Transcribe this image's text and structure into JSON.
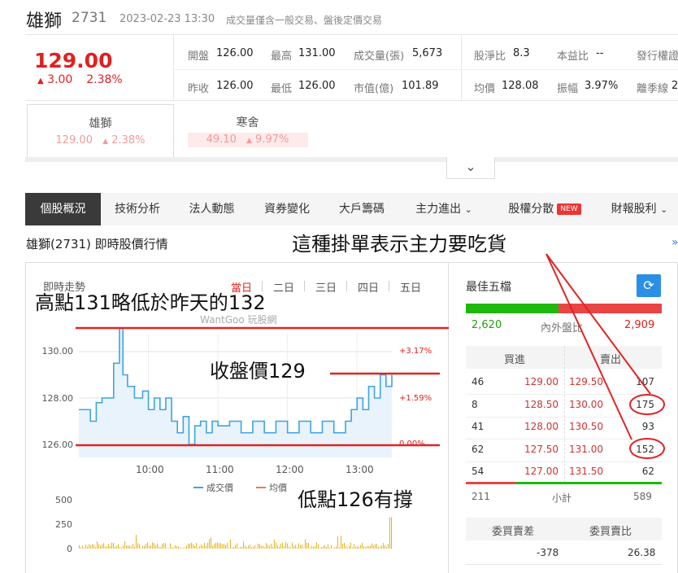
{
  "header": {
    "name": "雄獅",
    "code": "2731",
    "timestamp": "2023-02-23 13:30",
    "note": "成交量僅含一般交易、盤後定價交易"
  },
  "quote": {
    "price": "129.00",
    "change": "3.00",
    "change_pct": "2.38%",
    "fields": [
      {
        "label": "開盤",
        "value": "126.00"
      },
      {
        "label": "最高",
        "value": "131.00"
      },
      {
        "label": "成交量(張)",
        "value": "5,673"
      },
      {
        "label": "股淨比",
        "value": "8.3"
      },
      {
        "label": "本益比",
        "value": "--"
      },
      {
        "label": "發行權證",
        "value": ""
      },
      {
        "label": "昨收",
        "value": "126.00"
      },
      {
        "label": "最低",
        "value": "126.00"
      },
      {
        "label": "市值(億)",
        "value": "101.89"
      },
      {
        "label": "均價",
        "value": "128.08"
      },
      {
        "label": "振幅",
        "value": "3.97%"
      },
      {
        "label": "離季線",
        "value": "2"
      }
    ]
  },
  "related": [
    {
      "name": "雄獅",
      "price": "129.00",
      "pct": "2.38%"
    },
    {
      "name": "寒舍",
      "price": "49.10",
      "pct": "9.97%"
    }
  ],
  "tabs": [
    {
      "label": "個股概況"
    },
    {
      "label": "技術分析"
    },
    {
      "label": "法人動態"
    },
    {
      "label": "資券變化"
    },
    {
      "label": "大戶籌碼"
    },
    {
      "label": "主力進出"
    },
    {
      "label": "股權分散",
      "badge": "NEW"
    },
    {
      "label": "財報股利"
    }
  ],
  "section_title": "雄獅(2731) 即時股價行情",
  "more_link": "»",
  "chart": {
    "title": "即時走勢",
    "ranges": [
      "當日",
      "二日",
      "三日",
      "四日",
      "五日"
    ],
    "watermark": "WantGoo 玩股網",
    "y_ticks": [
      "130.00",
      "128.00",
      "126.00"
    ],
    "pct_ticks": [
      "+3.17%",
      "+1.59%",
      "0.00%"
    ],
    "x_ticks": [
      "10:00",
      "11:00",
      "12:00",
      "13:00"
    ],
    "legend": [
      "成交價",
      "均價"
    ],
    "vol_ticks": [
      "500",
      "250",
      "0"
    ],
    "colors": {
      "price_line": "#3fa4e0",
      "price_fill": "#e8f3fb",
      "avg_line": "#f07c3c",
      "volume": "#e5b324"
    }
  },
  "chart_data": {
    "type": "line",
    "title": "即時走勢",
    "xlabel": "",
    "ylabel": "",
    "ylim": [
      125.8,
      131.2
    ],
    "x_range": [
      "09:00",
      "13:30"
    ],
    "series": [
      {
        "name": "成交價",
        "x": [
          "09:00",
          "09:10",
          "09:15",
          "09:20",
          "09:30",
          "09:35",
          "09:38",
          "09:42",
          "09:48",
          "09:55",
          "10:00",
          "10:05",
          "10:10",
          "10:15",
          "10:20",
          "10:25",
          "10:30",
          "10:35",
          "10:40",
          "10:45",
          "10:50",
          "10:55",
          "11:00",
          "11:10",
          "11:20",
          "11:30",
          "11:40",
          "11:50",
          "12:00",
          "12:10",
          "12:20",
          "12:30",
          "12:40",
          "12:50",
          "12:55",
          "13:00",
          "13:05",
          "13:10",
          "13:15",
          "13:20",
          "13:25",
          "13:30"
        ],
        "values": [
          127.5,
          127.0,
          127.8,
          128.0,
          129.5,
          131.0,
          129.0,
          128.5,
          128.0,
          128.3,
          127.5,
          128.0,
          127.5,
          128.0,
          127.0,
          126.5,
          127.2,
          126.0,
          126.8,
          127.0,
          126.5,
          127.0,
          126.8,
          127.0,
          126.5,
          127.0,
          126.5,
          127.0,
          126.5,
          127.0,
          126.5,
          127.0,
          126.5,
          127.0,
          127.5,
          128.0,
          127.5,
          128.5,
          128.0,
          129.0,
          128.5,
          129.0
        ]
      }
    ],
    "volume": {
      "ticks": [
        0,
        250,
        500
      ],
      "peak": 320
    }
  },
  "best5": {
    "title": "最佳五檔",
    "inner_outer_label": "內外盤比",
    "inner": "2,620",
    "outer": "2,909",
    "inner_ratio": 0.474,
    "bid_label": "買進",
    "ask_label": "賣出",
    "rows": [
      {
        "bid_vol": "46",
        "bid": "129.00",
        "ask": "129.50",
        "ask_vol": "107"
      },
      {
        "bid_vol": "8",
        "bid": "128.50",
        "ask": "130.00",
        "ask_vol": "175"
      },
      {
        "bid_vol": "41",
        "bid": "128.00",
        "ask": "130.50",
        "ask_vol": "93"
      },
      {
        "bid_vol": "62",
        "bid": "127.50",
        "ask": "131.00",
        "ask_vol": "152"
      },
      {
        "bid_vol": "54",
        "bid": "127.00",
        "ask": "131.50",
        "ask_vol": "62"
      }
    ],
    "subtotal_label": "小計",
    "bid_total": "211",
    "ask_total": "589",
    "diff_label": "委買賣差",
    "ratio_label": "委買賣比",
    "diff": "-378",
    "ratio": "26.38"
  },
  "annotations": {
    "top": "這種掛單表示主力要吃貨",
    "high": "高點131略低於昨天的132",
    "close": "收盤價129",
    "low": "低點126有撐"
  }
}
